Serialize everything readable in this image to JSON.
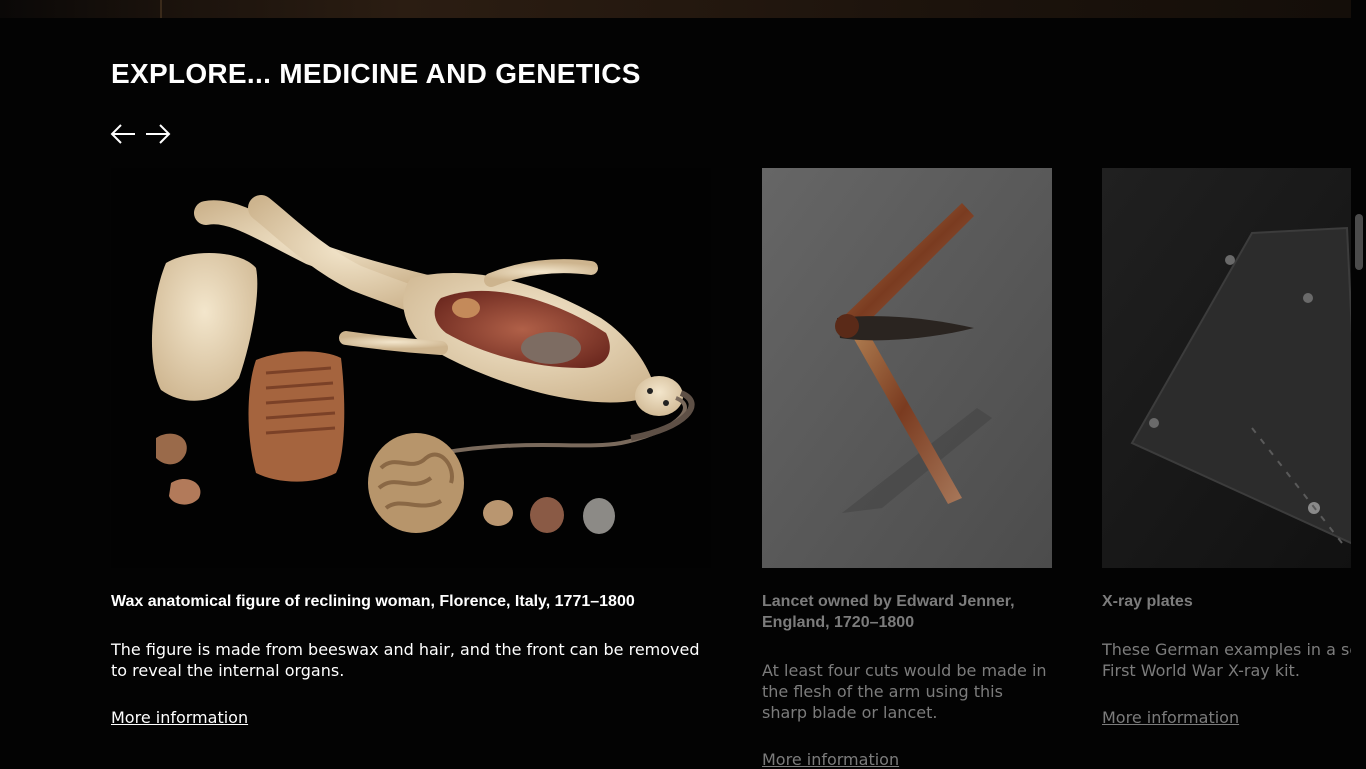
{
  "section": {
    "title": "EXPLORE... MEDICINE AND GENETICS",
    "prev_icon": "arrow-left-icon",
    "next_icon": "arrow-right-icon"
  },
  "cards": [
    {
      "title": "Wax anatomical figure of reclining woman, Florence, Italy, 1771–1800",
      "description": "The figure is made from beeswax and hair, and the front can be removed to reveal the internal organs.",
      "link": "More information"
    },
    {
      "title": "Lancet owned by Edward Jenner, England, 1720–1800",
      "description": "At least four cuts would be made in the flesh of the arm using this sharp blade or lancet.",
      "link": "More information"
    },
    {
      "title": "X-ray plates",
      "description": "These German examples in a se First World War X-ray kit.",
      "link": "More information"
    }
  ],
  "colors": {
    "background": "#030303",
    "text": "#ffffff",
    "dimmed_text": "#7c7c7c"
  }
}
